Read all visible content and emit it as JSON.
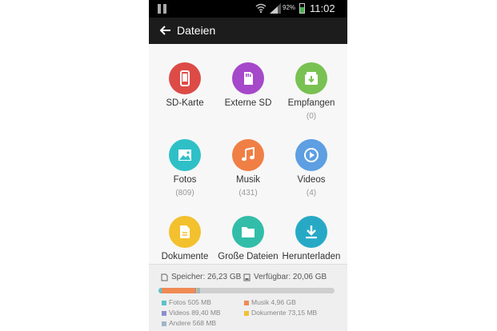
{
  "status_bar": {
    "battery": "92%",
    "time": "11:02"
  },
  "app_bar": {
    "title": "Dateien"
  },
  "grid": [
    {
      "label": "SD-Karte",
      "count": "",
      "color": "#dd4b47",
      "icon": "phone-icon"
    },
    {
      "label": "Externe SD",
      "count": "",
      "color": "#a548c9",
      "icon": "sd-card-icon"
    },
    {
      "label": "Empfangen",
      "count": "(0)",
      "color": "#79c152",
      "icon": "inbox-download-icon"
    },
    {
      "label": "Fotos",
      "count": "(809)",
      "color": "#2fc0c7",
      "icon": "image-icon"
    },
    {
      "label": "Musik",
      "count": "(431)",
      "color": "#f07f45",
      "icon": "music-note-icon"
    },
    {
      "label": "Videos",
      "count": "(4)",
      "color": "#5d9fe2",
      "icon": "play-icon"
    },
    {
      "label": "Dokumente",
      "count": "",
      "color": "#f3c12e",
      "icon": "document-icon"
    },
    {
      "label": "Große Dateien",
      "count": "",
      "color": "#32bda9",
      "icon": "folder-icon"
    },
    {
      "label": "Herunterladen",
      "count": "",
      "color": "#27a9c6",
      "icon": "download-icon"
    }
  ],
  "storage": {
    "total": "Speicher: 26,23 GB",
    "available": "Verfügbar: 20,06 GB",
    "segments": [
      {
        "name": "Fotos",
        "color": "#5bc3c9",
        "fraction": 0.019
      },
      {
        "name": "Musik",
        "color": "#ef8a55",
        "fraction": 0.19
      },
      {
        "name": "Videos",
        "color": "#8a8fd2",
        "fraction": 0.004
      },
      {
        "name": "Dokumente",
        "color": "#f1c232",
        "fraction": 0.003
      },
      {
        "name": "Andere",
        "color": "#9fb6c9",
        "fraction": 0.021
      }
    ],
    "legend": [
      {
        "label": "Fotos 505 MB",
        "color": "#5bc3c9"
      },
      {
        "label": "Musik 4,96 GB",
        "color": "#ef8a55"
      },
      {
        "label": "Videos 89,40 MB",
        "color": "#8a8fd2"
      },
      {
        "label": "Dokumente 73,15 MB",
        "color": "#f1c232"
      },
      {
        "label": "Andere 568 MB",
        "color": "#9fb6c9"
      }
    ]
  }
}
